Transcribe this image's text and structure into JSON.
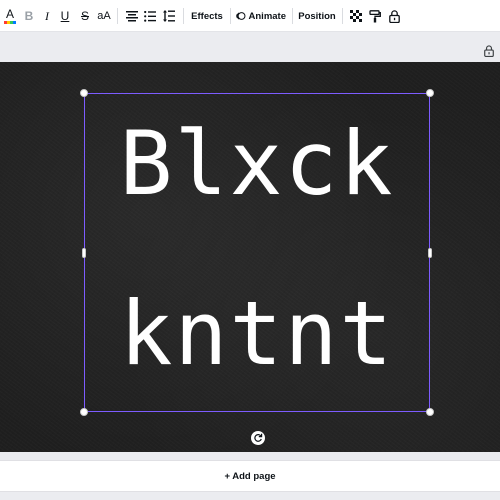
{
  "toolbar": {
    "text_color_icon": "text-color-icon",
    "text_color_letter": "A",
    "bold_label": "B",
    "italic_label": "I",
    "underline_label": "U",
    "strikethrough_label": "S",
    "case_label": "aA",
    "align_icon": "align-center-icon",
    "list_icon": "bullet-list-icon",
    "spacing_icon": "line-spacing-icon",
    "effects_label": "Effects",
    "animate_label": "Animate",
    "position_label": "Position",
    "transparency_icon": "transparency-icon",
    "paint_icon": "paint-roller-icon",
    "lock_icon": "lock-icon"
  },
  "page": {
    "lock_icon": "lock-icon"
  },
  "canvas": {
    "line1": "Blxck",
    "line2": "kntnt",
    "selection_color": "#7d5cff",
    "background_color": "#1f1f1f",
    "text_color": "#ffffff"
  },
  "footer": {
    "add_page_label": "+ Add page"
  }
}
